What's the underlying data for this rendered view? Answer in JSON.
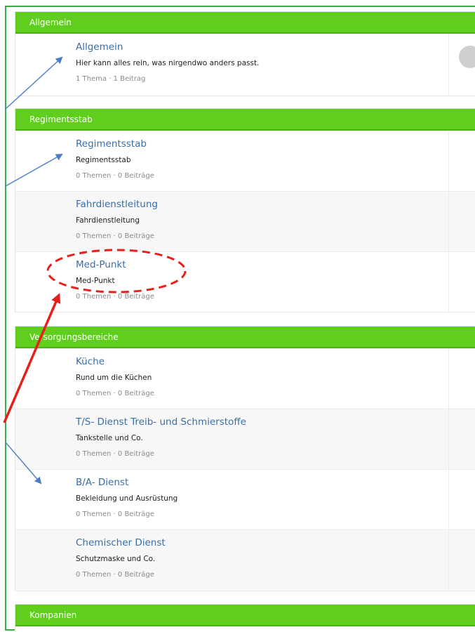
{
  "categories": [
    {
      "header": "Allgemein",
      "forums": [
        {
          "title": "Allgemein",
          "description": "Hier kann alles rein, was nirgendwo anders passt.",
          "stats": "1 Thema · 1 Beitrag"
        }
      ]
    },
    {
      "header": "Regimentsstab",
      "forums": [
        {
          "title": "Regimentsstab",
          "description": "Regimentsstab",
          "stats": "0 Themen · 0 Beiträge"
        },
        {
          "title": "Fahrdienstleitung",
          "description": "Fahrdienstleitung",
          "stats": "0 Themen · 0 Beiträge"
        },
        {
          "title": "Med-Punkt",
          "description": "Med-Punkt",
          "stats": "0 Themen · 0 Beiträge"
        }
      ]
    },
    {
      "header": "Versorgungsbereiche",
      "forums": [
        {
          "title": "Küche",
          "description": "Rund um die Küchen",
          "stats": "0 Themen · 0 Beiträge"
        },
        {
          "title": "T/S- Dienst Treib- und Schmierstoffe",
          "description": "Tankstelle und Co.",
          "stats": "0 Themen · 0 Beiträge"
        },
        {
          "title": "B/A- Dienst",
          "description": "Bekleidung und Ausrüstung",
          "stats": "0 Themen · 0 Beiträge"
        },
        {
          "title": "Chemischer Dienst",
          "description": "Schutzmaske und Co.",
          "stats": "0 Themen · 0 Beiträge"
        }
      ]
    },
    {
      "header": "Kompanien",
      "forums": []
    }
  ],
  "colors": {
    "header_green": "#5fce1c",
    "frame_green": "#3dae4a",
    "link_blue": "#3a6ea5",
    "arrow_blue": "#4a7cc7",
    "annotation_red": "#e8201b"
  },
  "icons": {
    "avatar": "avatar-placeholder-icon"
  }
}
